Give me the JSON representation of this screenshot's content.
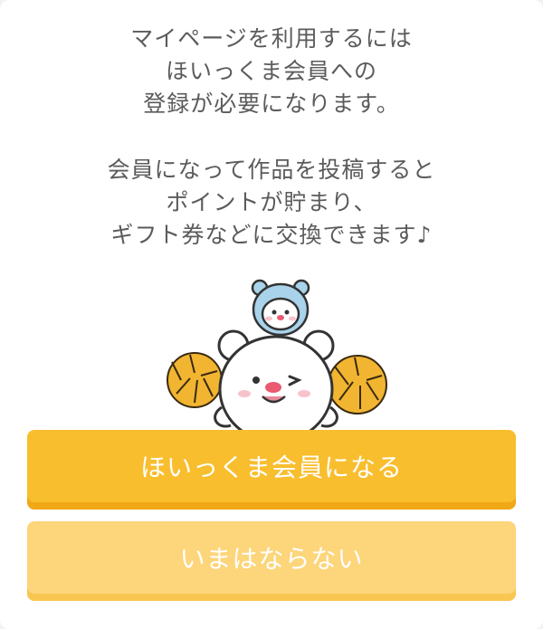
{
  "dialog": {
    "message1": [
      "マイページを利用するには",
      "ほいっくま会員への",
      "登録が必要になります。"
    ],
    "message2": [
      "会員になって作品を投稿すると",
      "ポイントが貯まり、",
      "ギフト券などに交換できます♪"
    ]
  },
  "buttons": {
    "join_label": "ほいっくま会員になる",
    "skip_label": "いまはならない"
  },
  "colors": {
    "primary": "#f8be2e",
    "secondary": "#fdd57a",
    "text": "#5b5b5b"
  },
  "icons": {
    "mascot": "bear-cheerleader-with-pompoms"
  }
}
